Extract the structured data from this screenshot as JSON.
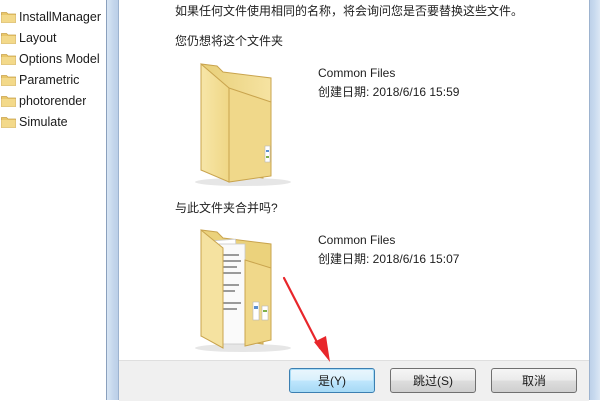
{
  "tree": {
    "items": [
      {
        "label": "InstallManager"
      },
      {
        "label": "Layout"
      },
      {
        "label": "Options Model"
      },
      {
        "label": "Parametric"
      },
      {
        "label": "photorender"
      },
      {
        "label": "Simulate"
      }
    ]
  },
  "dialog": {
    "message": "如果任何文件使用相同的名称，将会询问您是否要替换这些文件。",
    "existing_heading": "您仍想将这个文件夹",
    "existing_folder": {
      "name": "Common Files",
      "created": "创建日期: 2018/6/16 15:59"
    },
    "merge_heading": "与此文件夹合并吗?",
    "incoming_folder": {
      "name": "Common Files",
      "created": "创建日期: 2018/6/16 15:07"
    }
  },
  "buttons": {
    "yes_label": "是(Y)",
    "skip_label": "跳过(S)",
    "cancel_label": "取消"
  },
  "colors": {
    "folder": "#f0d77f",
    "annotation_arrow": "#e8262b",
    "default_button_border": "#3c7fb1"
  }
}
